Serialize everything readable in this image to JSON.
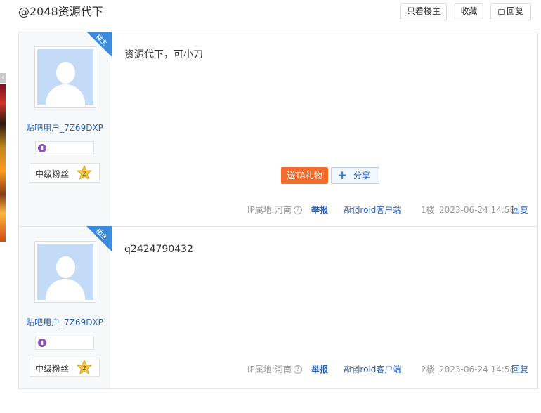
{
  "thread": {
    "title": "@2048资源代下",
    "buttons": {
      "only_owner": "只看楼主",
      "favorite": "收藏",
      "reply": "回复"
    }
  },
  "posts": [
    {
      "owner_badge": "楼主",
      "username": "贴吧用户_7Z69DXP",
      "level_title": "中级粉丝",
      "level_num": "2",
      "content": "资源代下，可小刀",
      "gift_label": "送TA礼物",
      "share_label": "分享",
      "ip_location": "IP属地:河南",
      "report": "举报",
      "from_prefix": "来自",
      "client": "Android客户端",
      "floor": "1楼",
      "time": "2023-06-24 14:58",
      "reply": "回复"
    },
    {
      "owner_badge": "楼主",
      "username": "贴吧用户_7Z69DXP",
      "level_title": "中级粉丝",
      "level_num": "2",
      "content": "q2424790432",
      "ip_location": "IP属地:河南",
      "report": "举报",
      "from_prefix": "来自",
      "client": "Android客户端",
      "floor": "2楼",
      "time": "2023-06-24 14:58",
      "reply": "回复"
    }
  ],
  "colors": {
    "link": "#2d64b3",
    "gift": "#f26d2b",
    "badge": "#3a8bde",
    "avatar_bg": "#c3dbf7"
  },
  "icons": [
    "owner-corner-badge",
    "default-avatar-icon",
    "medal-icon",
    "level-star-icon",
    "share-plus-icon",
    "question-icon",
    "warning-icon",
    "reply-bubble-icon"
  ]
}
